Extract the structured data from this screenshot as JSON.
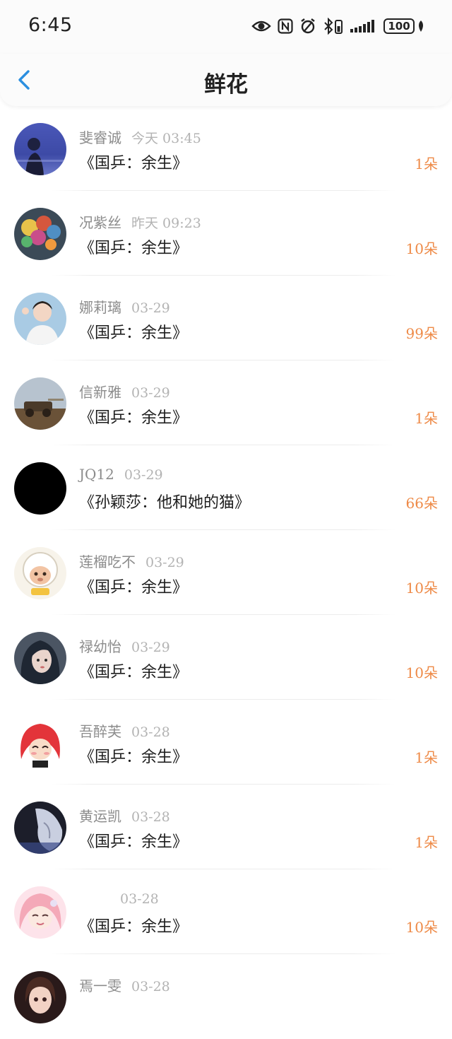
{
  "status_bar": {
    "time": "6:45",
    "battery": "100",
    "icons": [
      "eye-icon",
      "nfc-icon",
      "alarm-icon",
      "bluetooth-battery-icon",
      "signal-icon",
      "battery-icon",
      "leaf-icon"
    ]
  },
  "header": {
    "title": "鲜花",
    "back_icon": "chevron-left-icon"
  },
  "colors": {
    "accent": "#2b8fe0",
    "count": "#ee8a47",
    "name": "#8c8c8c"
  },
  "gifts": [
    {
      "name": "斐睿诚",
      "date": "今天 03:45",
      "book": "《国乒：余生》",
      "count": "1朵"
    },
    {
      "name": "况紫丝",
      "date": "昨天 09:23",
      "book": "《国乒：余生》",
      "count": "10朵"
    },
    {
      "name": "娜莉璃",
      "date": "03-29",
      "book": "《国乒：余生》",
      "count": "99朵"
    },
    {
      "name": "信新雅",
      "date": "03-29",
      "book": "《国乒：余生》",
      "count": "1朵"
    },
    {
      "name": "JQ12",
      "date": "03-29",
      "book": "《孙颖莎：他和她的猫》",
      "count": "66朵"
    },
    {
      "name": "莲榴吃不",
      "date": "03-29",
      "book": "《国乒：余生》",
      "count": "10朵"
    },
    {
      "name": "禄幼怡",
      "date": "03-29",
      "book": "《国乒：余生》",
      "count": "10朵"
    },
    {
      "name": "吾醉芙",
      "date": "03-28",
      "book": "《国乒：余生》",
      "count": "1朵"
    },
    {
      "name": "黄运凯",
      "date": "03-28",
      "book": "《国乒：余生》",
      "count": "1朵"
    },
    {
      "name": "",
      "date": "03-28",
      "book": "《国乒：余生》",
      "count": "10朵"
    },
    {
      "name": "焉一雯",
      "date": "03-28",
      "book": "",
      "count": ""
    }
  ]
}
